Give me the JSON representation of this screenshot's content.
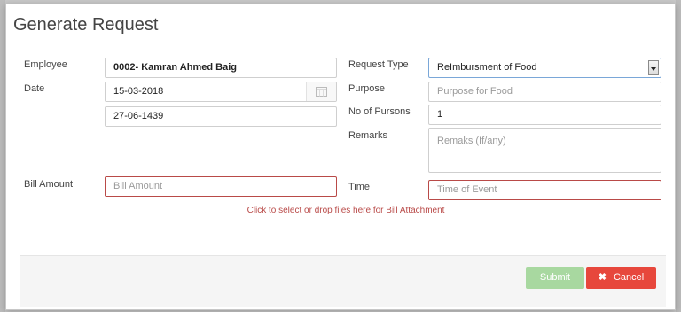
{
  "title": "Generate Request",
  "form": {
    "employee_label": "Employee",
    "employee_value": "0002- Kamran Ahmed Baig",
    "date_label": "Date",
    "date_gregorian": "15-03-2018",
    "date_hijri": "27-06-1439",
    "bill_amount_label": "Bill Amount",
    "bill_amount_placeholder": "Bill Amount",
    "request_type_label": "Request Type",
    "request_type_value": "ReImbursment of Food",
    "purpose_label": "Purpose",
    "purpose_placeholder": "Purpose for Food",
    "persons_label": "No of Pursons",
    "persons_value": "1",
    "remarks_label": "Remarks",
    "remarks_placeholder": "Remaks (If/any)",
    "time_label": "Time",
    "time_placeholder": "Time of Event",
    "attachment_text": "Click to select or drop files here for Bill Attachment"
  },
  "footer": {
    "submit_label": "Submit",
    "cancel_label": "Cancel",
    "cancel_icon": "close-icon"
  },
  "colors": {
    "submit_bg": "#a8d8a0",
    "cancel_bg": "#e7473c",
    "error": "#b94a48"
  }
}
